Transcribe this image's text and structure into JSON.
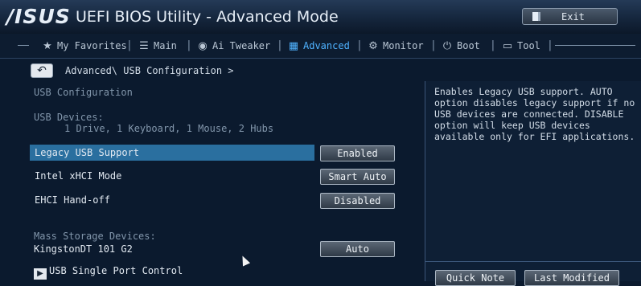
{
  "header": {
    "logo_text": "/ISUS",
    "title": "UEFI BIOS Utility - Advanced Mode",
    "exit_label": "Exit"
  },
  "nav": {
    "items": [
      {
        "label": "My Favorites",
        "icon": "star-icon",
        "glyph": "★",
        "active": false
      },
      {
        "label": "Main",
        "icon": "list-icon",
        "glyph": "☰",
        "active": false
      },
      {
        "label": "Ai Tweaker",
        "icon": "tweaker-icon",
        "glyph": "◉",
        "active": false
      },
      {
        "label": "Advanced",
        "icon": "advanced-icon",
        "glyph": "▦",
        "active": true
      },
      {
        "label": "Monitor",
        "icon": "monitor-icon",
        "glyph": "⚙",
        "active": false
      },
      {
        "label": "Boot",
        "icon": "power-icon",
        "glyph": "⏻",
        "active": false
      },
      {
        "label": "Tool",
        "icon": "tool-icon",
        "glyph": "▭",
        "active": false
      }
    ],
    "separator": "|"
  },
  "breadcrumb": {
    "back_glyph": "↶",
    "path": "Advanced\\ USB Configuration >"
  },
  "config": {
    "section_title": "USB Configuration",
    "devices_label": "USB Devices:",
    "devices_value": "1 Drive, 1 Keyboard, 1 Mouse, 2 Hubs",
    "settings": [
      {
        "label": "Legacy USB Support",
        "value": "Enabled",
        "highlighted": true
      },
      {
        "label": "Intel xHCI Mode",
        "value": "Smart Auto",
        "highlighted": false
      },
      {
        "label": "EHCI Hand-off",
        "value": "Disabled",
        "highlighted": false
      }
    ],
    "mass_storage_label": "Mass Storage Devices:",
    "mass_storage_device": "KingstonDT 101 G2",
    "mass_storage_value": "Auto",
    "submenu_label": "USB Single Port Control",
    "submenu_glyph": "▶"
  },
  "help": {
    "text": "Enables Legacy USB support. AUTO option disables legacy support if no USB devices are connected. DISABLE option will keep USB devices available only for EFI applications."
  },
  "footer": {
    "quick_note": "Quick Note",
    "last_modified": "Last Modified"
  },
  "colors": {
    "background": "#0b1a2e",
    "accent_active": "#4fb2ff",
    "highlight_row": "#2a6f9f"
  }
}
